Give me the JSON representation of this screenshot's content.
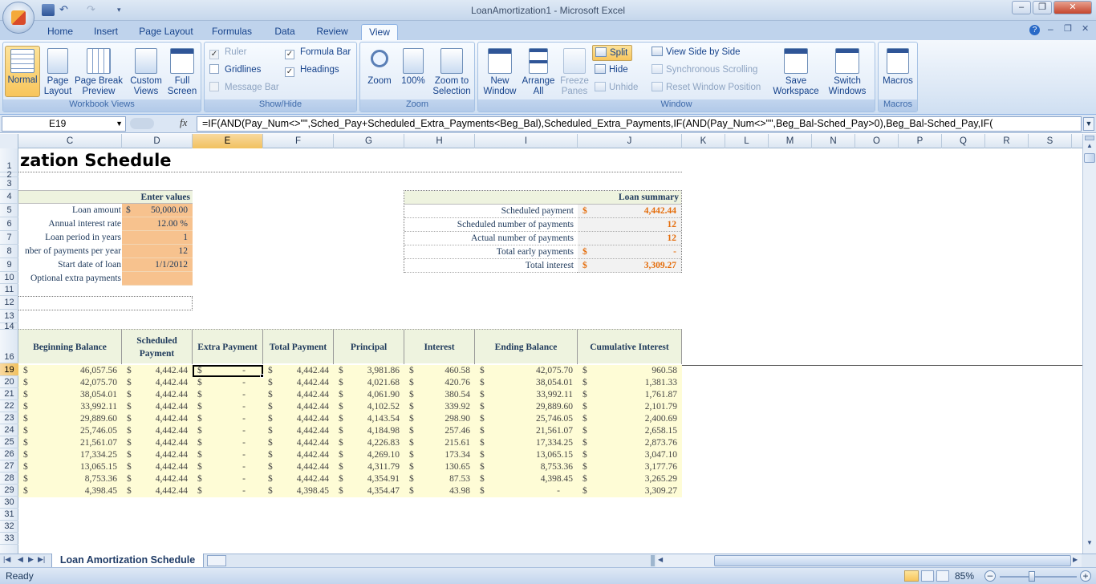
{
  "window": {
    "title": "LoanAmortization1 - Microsoft Excel"
  },
  "tabs": [
    "Home",
    "Insert",
    "Page Layout",
    "Formulas",
    "Data",
    "Review",
    "View"
  ],
  "active_tab": "View",
  "ribbon": {
    "workbook_views": {
      "label": "Workbook Views",
      "normal": "Normal",
      "page_layout": "Page\nLayout",
      "page_break": "Page Break\nPreview",
      "custom_views": "Custom\nViews",
      "full_screen": "Full\nScreen"
    },
    "show_hide": {
      "label": "Show/Hide",
      "ruler": "Ruler",
      "gridlines": "Gridlines",
      "message_bar": "Message Bar",
      "formula_bar": "Formula Bar",
      "headings": "Headings"
    },
    "zoom": {
      "label": "Zoom",
      "zoom": "Zoom",
      "hundred": "100%",
      "zoom_selection": "Zoom to\nSelection"
    },
    "window": {
      "label": "Window",
      "new_window": "New\nWindow",
      "arrange_all": "Arrange\nAll",
      "freeze_panes": "Freeze\nPanes",
      "split": "Split",
      "hide": "Hide",
      "unhide": "Unhide",
      "side_by_side": "View Side by Side",
      "sync_scroll": "Synchronous Scrolling",
      "reset_pos": "Reset Window Position",
      "save_workspace": "Save\nWorkspace",
      "switch_windows": "Switch\nWindows"
    },
    "macros": {
      "label": "Macros",
      "macros": "Macros"
    }
  },
  "formula_bar": {
    "name_box": "E19",
    "fx": "fx",
    "formula": "=IF(AND(Pay_Num<>\"\",Sched_Pay+Scheduled_Extra_Payments<Beg_Bal),Scheduled_Extra_Payments,IF(AND(Pay_Num<>\"\",Beg_Bal-Sched_Pay>0),Beg_Bal-Sched_Pay,IF("
  },
  "columns": [
    "C",
    "D",
    "E",
    "F",
    "G",
    "H",
    "I",
    "J",
    "K",
    "L",
    "M",
    "N",
    "O",
    "P",
    "Q",
    "R",
    "S"
  ],
  "rows": [
    "1",
    "2",
    "3",
    "4",
    "5",
    "6",
    "7",
    "8",
    "9",
    "10",
    "11",
    "12",
    "13",
    "14",
    "16",
    "19",
    "20",
    "21",
    "22",
    "23",
    "24",
    "25",
    "26",
    "27",
    "28",
    "29",
    "30",
    "31",
    "32",
    "33"
  ],
  "sheet": {
    "title": "zation Schedule",
    "enter_values": {
      "header": "Enter values",
      "rows": [
        {
          "label": "Loan amount",
          "cur": "$",
          "value": "50,000.00"
        },
        {
          "label": "Annual interest rate",
          "cur": "",
          "value": "12.00  %"
        },
        {
          "label": "Loan period in years",
          "cur": "",
          "value": "1"
        },
        {
          "label": "nber of payments per year",
          "cur": "",
          "value": "12"
        },
        {
          "label": "Start date of loan",
          "cur": "",
          "value": "1/1/2012"
        },
        {
          "label": "Optional extra payments",
          "cur": "",
          "value": ""
        }
      ]
    },
    "loan_summary": {
      "header": "Loan summary",
      "rows": [
        {
          "label": "Scheduled payment",
          "cur": "$",
          "value": "4,442.44"
        },
        {
          "label": "Scheduled number of payments",
          "cur": "",
          "value": "12"
        },
        {
          "label": "Actual number of payments",
          "cur": "",
          "value": "12"
        },
        {
          "label": "Total early payments",
          "cur": "$",
          "value": "-"
        },
        {
          "label": "Total interest",
          "cur": "$",
          "value": "3,309.27"
        }
      ]
    },
    "table_headers": [
      "Beginning Balance",
      "Scheduled\nPayment",
      "Extra Payment",
      "Total Payment",
      "Principal",
      "Interest",
      "Ending Balance",
      "Cumulative Interest"
    ],
    "table_rows": [
      [
        "46,057.56",
        "4,442.44",
        "-",
        "4,442.44",
        "3,981.86",
        "460.58",
        "42,075.70",
        "960.58"
      ],
      [
        "42,075.70",
        "4,442.44",
        "-",
        "4,442.44",
        "4,021.68",
        "420.76",
        "38,054.01",
        "1,381.33"
      ],
      [
        "38,054.01",
        "4,442.44",
        "-",
        "4,442.44",
        "4,061.90",
        "380.54",
        "33,992.11",
        "1,761.87"
      ],
      [
        "33,992.11",
        "4,442.44",
        "-",
        "4,442.44",
        "4,102.52",
        "339.92",
        "29,889.60",
        "2,101.79"
      ],
      [
        "29,889.60",
        "4,442.44",
        "-",
        "4,442.44",
        "4,143.54",
        "298.90",
        "25,746.05",
        "2,400.69"
      ],
      [
        "25,746.05",
        "4,442.44",
        "-",
        "4,442.44",
        "4,184.98",
        "257.46",
        "21,561.07",
        "2,658.15"
      ],
      [
        "21,561.07",
        "4,442.44",
        "-",
        "4,442.44",
        "4,226.83",
        "215.61",
        "17,334.25",
        "2,873.76"
      ],
      [
        "17,334.25",
        "4,442.44",
        "-",
        "4,442.44",
        "4,269.10",
        "173.34",
        "13,065.15",
        "3,047.10"
      ],
      [
        "13,065.15",
        "4,442.44",
        "-",
        "4,442.44",
        "4,311.79",
        "130.65",
        "8,753.36",
        "3,177.76"
      ],
      [
        "8,753.36",
        "4,442.44",
        "-",
        "4,442.44",
        "4,354.91",
        "87.53",
        "4,398.45",
        "3,265.29"
      ],
      [
        "4,398.45",
        "4,442.44",
        "-",
        "4,398.45",
        "4,354.47",
        "43.98",
        "-",
        "3,309.27"
      ]
    ],
    "currency": "$"
  },
  "sheet_tab": "Loan Amortization Schedule",
  "status": {
    "ready": "Ready",
    "zoom": "85%"
  },
  "colors": {
    "accent_orange": "#f7c28e",
    "table_fill": "#fefcd6",
    "summary_value": "#e46c0a"
  }
}
